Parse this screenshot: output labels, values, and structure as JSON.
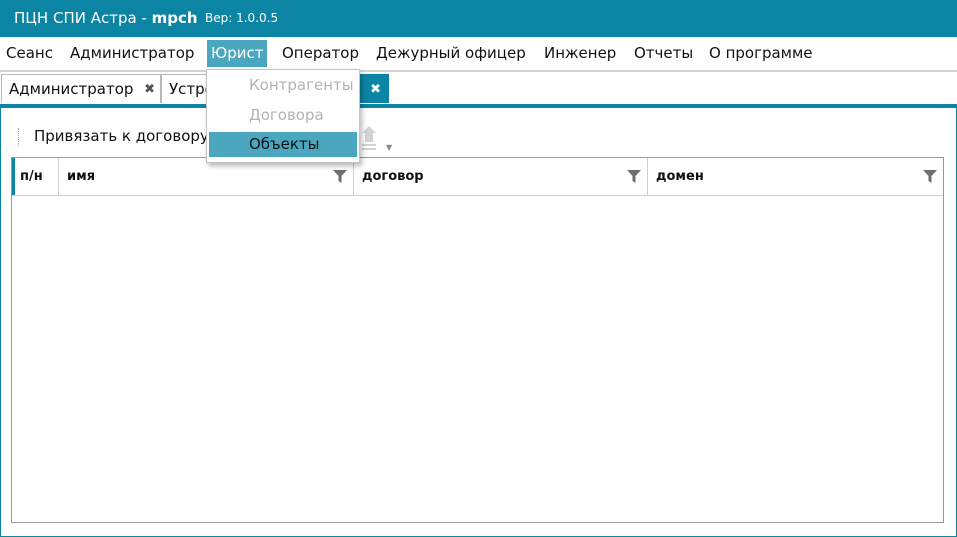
{
  "titlebar": {
    "app": "ПЦН СПИ Астра - ",
    "user": "mpch",
    "version": "Вер: 1.0.0.5"
  },
  "menu": [
    "Сеанс",
    "Администратор",
    "Юрист",
    "Оператор",
    "Дежурный офицер",
    "Инженер",
    "Отчеты",
    "О программе"
  ],
  "active_menu_index": 2,
  "tabs": [
    {
      "label": "Администратор"
    },
    {
      "label": "Устро"
    },
    {
      "label": ""
    }
  ],
  "toolbar": {
    "bind_button": "Привязать к договору",
    "icon": "upload-icon"
  },
  "grid": {
    "columns": [
      "п/н",
      "имя",
      "договор",
      "домен"
    ],
    "filter_icon": "filter-icon",
    "rows": []
  },
  "dropdown": {
    "items": [
      {
        "label": "Контрагенты",
        "state": "disabled"
      },
      {
        "label": "Договора",
        "state": "disabled"
      },
      {
        "label": "Объекты",
        "state": "selected"
      }
    ]
  },
  "colors": {
    "accent": "#0b85a3",
    "highlight": "#4ba6c0"
  }
}
